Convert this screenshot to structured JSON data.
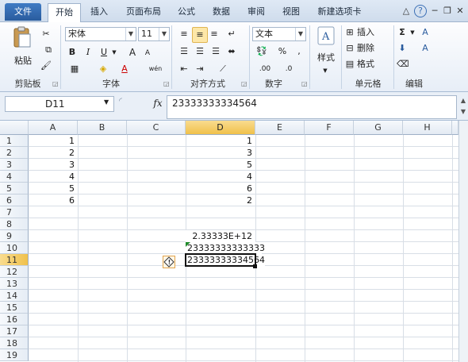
{
  "tabs": {
    "file": "文件",
    "home": "开始",
    "insert": "插入",
    "page_layout": "页面布局",
    "formulas": "公式",
    "data": "数据",
    "review": "审阅",
    "view": "视图",
    "new_tab": "新建选项卡"
  },
  "window_controls": {
    "collapse": "△",
    "help": "?",
    "minimize": "─",
    "restore": "❐",
    "close": "✕"
  },
  "clipboard": {
    "paste": "粘贴",
    "group": "剪贴板"
  },
  "font": {
    "name": "宋体",
    "size": "11",
    "group": "字体",
    "bold": "B",
    "italic": "I",
    "underline": "U",
    "grow": "A",
    "shrink": "A",
    "font_color": "A",
    "phonetic": "wén"
  },
  "alignment": {
    "group": "对齐方式"
  },
  "number": {
    "format": "文本",
    "percent": "%",
    "comma": ",",
    "group": "数字",
    "inc_dec": ".00",
    "dec_dec": ".0"
  },
  "styles": {
    "label": "样式"
  },
  "cells": {
    "insert": "插入",
    "delete": "删除",
    "format": "格式",
    "group": "单元格"
  },
  "editing": {
    "sum": "Σ",
    "sort": "A",
    "find": "A",
    "group": "编辑"
  },
  "formula_bar": {
    "name_box": "D11",
    "fx": "fx",
    "content": "23333333334564"
  },
  "grid": {
    "columns": [
      "A",
      "B",
      "C",
      "D",
      "E",
      "F",
      "G",
      "H"
    ],
    "rows": [
      "1",
      "2",
      "3",
      "4",
      "5",
      "6",
      "7",
      "8",
      "9",
      "10",
      "11",
      "12",
      "13",
      "14",
      "15",
      "16",
      "17",
      "18",
      "19"
    ],
    "col_a": [
      "1",
      "2",
      "3",
      "4",
      "5",
      "6"
    ],
    "col_d": [
      "1",
      "3",
      "5",
      "4",
      "6",
      "2"
    ],
    "d9": "2.33333E+12",
    "d10": "23333333333333",
    "d11": "23333333334564",
    "selected_col": "D",
    "selected_row": "11"
  },
  "colors": {
    "selection_header": "#f0c14b",
    "file_tab": "#2a5c9e",
    "error_triangle": "#1e8a2a"
  },
  "icons": {
    "error_smart_tag": "warning-diamond-icon"
  }
}
